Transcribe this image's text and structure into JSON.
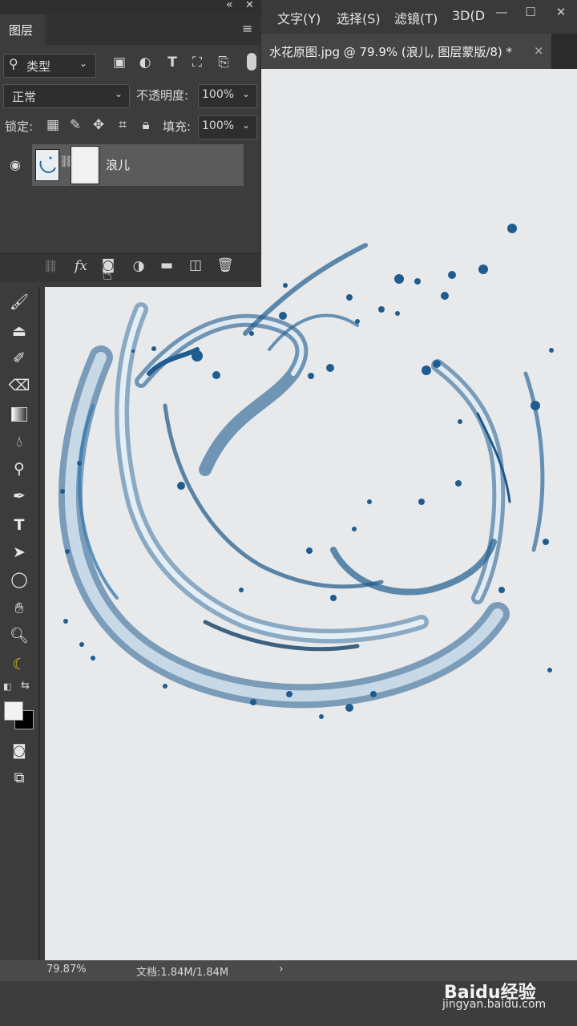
{
  "menu": {
    "items": [
      "文字(Y)",
      "选择(S)",
      "滤镜(T)",
      "3D(D"
    ],
    "min_glyph": "—",
    "max_glyph": "☐",
    "close_glyph": "✕"
  },
  "document": {
    "tab_title": "水花原图.jpg @ 79.9% (浪儿, 图层蒙版/8) *",
    "close_glyph": "×"
  },
  "layers_panel": {
    "collapse_glyph": "«",
    "close_glyph": "✕",
    "tab_label": "图层",
    "menu_glyph": "≡",
    "filter_kind": "类型",
    "blend_mode": "正常",
    "opacity_label": "不透明度:",
    "opacity_value": "100%",
    "lock_label": "锁定:",
    "fill_label": "填充:",
    "fill_value": "100%",
    "layer": {
      "name": "浪儿",
      "visible": true
    },
    "bottom_fx": "fx"
  },
  "toolbar": {
    "tools": [
      "brush",
      "clone-stamp",
      "history-brush",
      "eraser",
      "gradient",
      "blur",
      "dodge",
      "pen",
      "type",
      "path-selection",
      "ellipse",
      "hand",
      "zoom",
      "extra"
    ]
  },
  "colors": {
    "foreground": "#f2f2f2",
    "background": "#000000",
    "canvas": "#e8e9eb",
    "water": "#1f5c8f"
  },
  "status": {
    "zoom": "79.87%",
    "doc_info": "文档:1.84M/1.84M",
    "arrow": "›"
  },
  "watermark": {
    "brand": "Baidu经验",
    "url": "jingyan.baidu.com"
  }
}
